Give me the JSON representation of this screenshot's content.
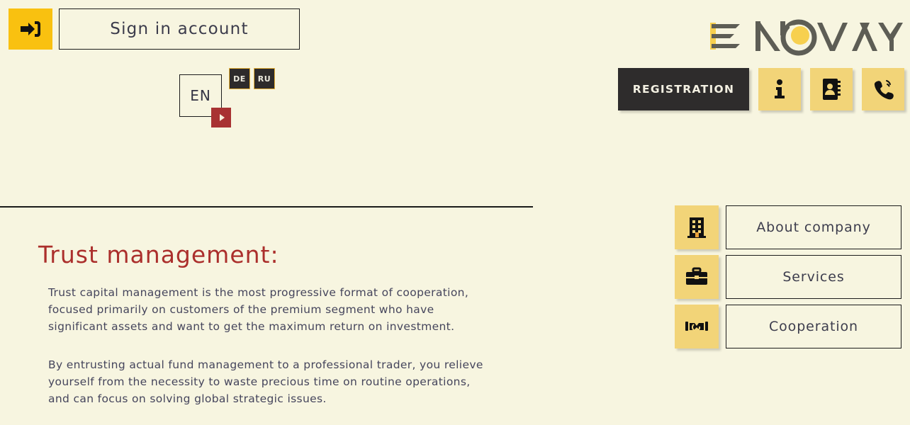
{
  "theme": {
    "background": "#f7f5e0",
    "accent_yellow": "#f9c110",
    "accent_gold": "#f2d478",
    "dark": "#2e2c2c",
    "title_red": "#ab2f2c",
    "toggle_red": "#a83232",
    "text": "#45455c"
  },
  "header": {
    "signin_icon": "sign-in-icon",
    "signin_label": "Sign in account",
    "registration_label": "REGISTRATION",
    "info_icon": "info-icon",
    "contacts_icon": "address-book-icon",
    "phone_icon": "phone-ring-icon"
  },
  "logo": {
    "text": "ENOVAY",
    "letters": [
      "E",
      "N",
      "O",
      "V",
      "A",
      "Y"
    ],
    "mark": "circle-o-mark",
    "letter_color": "#5d5d55",
    "accent_color": "#f7d04f"
  },
  "language": {
    "current": "EN",
    "toggle_icon": "play-triangle-icon",
    "options": [
      "DE",
      "RU"
    ]
  },
  "main": {
    "title": "Trust management:",
    "paragraphs": [
      "Trust capital management is the most progressive format of cooperation, focused primarily on customers of the premium segment who have significant assets and want to get the maximum return on investment.",
      "By entrusting actual fund management to a professional trader, you relieve yourself from the necessity to waste precious time on routine operations, and can focus on solving global strategic issues."
    ]
  },
  "rightnav": {
    "items": [
      {
        "label": "About company",
        "icon": "building-icon"
      },
      {
        "label": "Services",
        "icon": "briefcase-icon"
      },
      {
        "label": "Cooperation",
        "icon": "handshake-icon"
      }
    ]
  }
}
